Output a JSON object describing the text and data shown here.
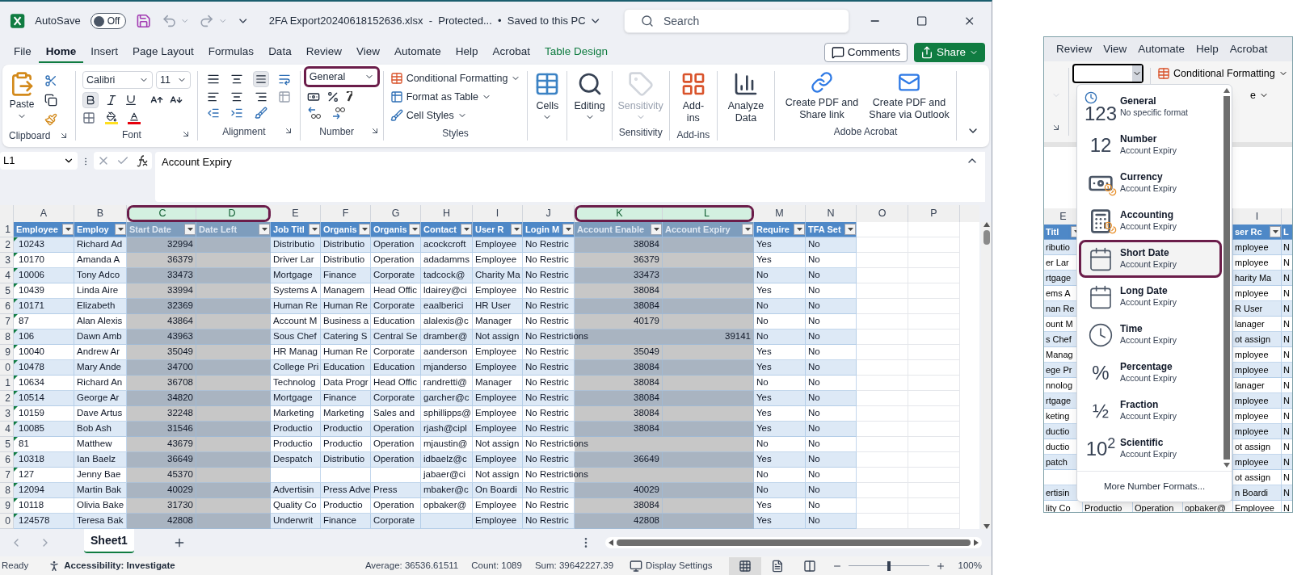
{
  "title_bar": {
    "autosave_label": "AutoSave",
    "autosave": {
      "on": false,
      "label": "Off"
    },
    "title": "2FA Export20240618152636.xlsx  -  Protected...  •  Saved to this PC",
    "search_placeholder": "Search"
  },
  "tabs": [
    {
      "label": "File",
      "selected": false,
      "kind": "normal"
    },
    {
      "label": "Home",
      "selected": true,
      "kind": "normal"
    },
    {
      "label": "Insert",
      "selected": false,
      "kind": "normal"
    },
    {
      "label": "Page Layout",
      "selected": false,
      "kind": "normal"
    },
    {
      "label": "Formulas",
      "selected": false,
      "kind": "normal"
    },
    {
      "label": "Data",
      "selected": false,
      "kind": "normal"
    },
    {
      "label": "Review",
      "selected": false,
      "kind": "normal"
    },
    {
      "label": "View",
      "selected": false,
      "kind": "normal"
    },
    {
      "label": "Automate",
      "selected": false,
      "kind": "normal"
    },
    {
      "label": "Help",
      "selected": false,
      "kind": "normal"
    },
    {
      "label": "Acrobat",
      "selected": false,
      "kind": "normal"
    },
    {
      "label": "Table Design",
      "selected": false,
      "kind": "contextual"
    }
  ],
  "comments_button": "Comments",
  "share_button": "Share",
  "ribbon": {
    "clipboard": {
      "paste": "Paste",
      "label": "Clipboard"
    },
    "font": {
      "name": "Calibri",
      "size": "11",
      "label": "Font"
    },
    "alignment": {
      "label": "Alignment"
    },
    "number": {
      "format": "General",
      "highlighted": true,
      "label": "Number"
    },
    "styles": {
      "items": [
        "Conditional Formatting",
        "Format as Table",
        "Cell Styles"
      ],
      "label": "Styles"
    },
    "tool_groups": [
      {
        "buttons": [
          {
            "kind": "cells",
            "label": "Cells",
            "dropdown": true,
            "disabled": false
          }
        ]
      },
      {
        "buttons": [
          {
            "kind": "editing",
            "label": "Editing",
            "dropdown": true,
            "disabled": false
          }
        ]
      },
      {
        "label": "Sensitivity",
        "buttons": [
          {
            "kind": "sensitivity",
            "label": "Sensitivity",
            "dropdown": true,
            "disabled": true
          }
        ]
      },
      {
        "label": "Add-ins",
        "buttons": [
          {
            "kind": "addins",
            "label": "Add-ins",
            "dropdown": false,
            "disabled": false
          }
        ]
      },
      {
        "buttons": [
          {
            "kind": "analyze",
            "label": "Analyze Data",
            "dropdown": false,
            "disabled": false
          }
        ]
      },
      {
        "label": "Adobe Acrobat",
        "buttons": [
          {
            "kind": "pdf_link",
            "label": "Create PDF and Share link",
            "dropdown": false,
            "disabled": false
          },
          {
            "kind": "pdf_mail",
            "label": "Create PDF and Share via Outlook",
            "dropdown": false,
            "disabled": false
          }
        ]
      }
    ]
  },
  "formula_bar": {
    "name_box": "L1",
    "formula": "Account Expiry"
  },
  "grid": {
    "columns": [
      {
        "letter": "A",
        "selected": false,
        "numeric": false
      },
      {
        "letter": "B",
        "selected": false,
        "numeric": false
      },
      {
        "letter": "C",
        "selected": true,
        "numeric": true
      },
      {
        "letter": "D",
        "selected": true
      },
      {
        "letter": "E",
        "selected": false,
        "numeric": false
      },
      {
        "letter": "F",
        "selected": false,
        "numeric": false
      },
      {
        "letter": "G",
        "selected": false,
        "numeric": false
      },
      {
        "letter": "H",
        "selected": false,
        "numeric": false
      },
      {
        "letter": "I",
        "selected": false,
        "numeric": false
      },
      {
        "letter": "J",
        "selected": false,
        "numeric": false
      },
      {
        "letter": "K",
        "selected": true,
        "numeric": true
      },
      {
        "letter": "L",
        "selected": true,
        "numeric": true
      },
      {
        "letter": "M",
        "selected": false,
        "numeric": false
      },
      {
        "letter": "N",
        "selected": false,
        "numeric": false
      },
      {
        "letter": "O",
        "selected": false
      },
      {
        "letter": "P",
        "selected": false
      }
    ],
    "header_row": {
      "n": "1",
      "cells": {
        "A": "Employee",
        "B": "Employ",
        "C": "Start Date",
        "D": "Date Left",
        "E": "Job Titl",
        "F": "Organis",
        "G": "Organis",
        "H": "Contact",
        "I": "User R",
        "J": "Login M",
        "K": "Account Enable",
        "L": "Account Expiry",
        "M": "Require",
        "N": "TFA Set"
      }
    },
    "rows": [
      {
        "n": "2",
        "cells": {
          "A": "10243",
          "B": "Richard Ad",
          "C": "32994",
          "E": "Distributio",
          "F": "Distributio",
          "G": "Operation",
          "H": "acockcroft",
          "I": "Employee",
          "J": "No Restric",
          "K": "38084",
          "M": "Yes",
          "N": "No"
        }
      },
      {
        "n": "3",
        "cells": {
          "A": "10170",
          "B": "Amanda A",
          "C": "36379",
          "E": "Driver Lar",
          "F": "Distributio",
          "G": "Operation",
          "H": "adadamms",
          "I": "Employee",
          "J": "No Restric",
          "K": "36379",
          "M": "Yes",
          "N": "No"
        }
      },
      {
        "n": "4",
        "cells": {
          "A": "10006",
          "B": "Tony Adco",
          "C": "33473",
          "E": "Mortgage",
          "F": "Finance",
          "G": "Corporate",
          "H": "tadcock@",
          "I": "Charity Ma",
          "J": "No Restric",
          "K": "33473",
          "M": "No",
          "N": "No"
        }
      },
      {
        "n": "5",
        "cells": {
          "A": "10439",
          "B": "Linda Aire",
          "C": "33994",
          "E": "Systems A",
          "F": "Managem",
          "G": "Head Offic",
          "H": "ldairey@ci",
          "I": "Employee",
          "J": "No Restric",
          "K": "38084",
          "M": "Yes",
          "N": "No"
        }
      },
      {
        "n": "6",
        "cells": {
          "A": "10171",
          "B": "Elizabeth",
          "C": "32369",
          "E": "Human Re",
          "F": "Human Re",
          "G": "Corporate",
          "H": "eaalberici",
          "I": "HR User",
          "J": "No Restric",
          "K": "38084",
          "M": "No",
          "N": "No"
        }
      },
      {
        "n": "7",
        "cells": {
          "A": "87",
          "B": "Alan Alexis",
          "C": "43864",
          "E": "Account M",
          "F": "Business a",
          "G": "Education",
          "H": "alalexis@c",
          "I": "Manager",
          "J": "No Restric",
          "K": "40179",
          "M": "No",
          "N": "No"
        }
      },
      {
        "n": "8",
        "cells": {
          "A": "106",
          "B": "Dawn Amb",
          "C": "43963",
          "E": "Sous Chef",
          "F": "Catering S",
          "G": "Central Se",
          "H": "dramber@",
          "I": "Not assign",
          "J": "No Restrictions",
          "L": "39141",
          "M": "No",
          "N": "No"
        }
      },
      {
        "n": "9",
        "cells": {
          "A": "10040",
          "B": "Andrew Ar",
          "C": "35049",
          "E": "HR Manag",
          "F": "Human Re",
          "G": "Corporate",
          "H": "aanderson",
          "I": "Employee",
          "J": "No Restric",
          "K": "35049",
          "M": "Yes",
          "N": "No"
        }
      },
      {
        "n": "0",
        "cells": {
          "A": "10478",
          "B": "Mary Ande",
          "C": "34700",
          "E": "College Pri",
          "F": "Education",
          "G": "Education",
          "H": "mjanderso",
          "I": "Employee",
          "J": "No Restric",
          "K": "38084",
          "M": "Yes",
          "N": "No"
        }
      },
      {
        "n": "1",
        "cells": {
          "A": "10634",
          "B": "Richard An",
          "C": "36708",
          "E": "Technolog",
          "F": "Data Progr",
          "G": "Head Offic",
          "H": "randretti@",
          "I": "Manager",
          "J": "No Restric",
          "K": "38084",
          "M": "No",
          "N": "No"
        }
      },
      {
        "n": "2",
        "cells": {
          "A": "10514",
          "B": "George Ar",
          "C": "34820",
          "E": "Mortgage",
          "F": "Finance",
          "G": "Corporate",
          "H": "garcher@c",
          "I": "Employee",
          "J": "No Restric",
          "K": "38084",
          "M": "Yes",
          "N": "No"
        }
      },
      {
        "n": "3",
        "cells": {
          "A": "10159",
          "B": "Dave Artus",
          "C": "32248",
          "E": "Marketing",
          "F": "Marketing",
          "G": "Sales and",
          "H": "sphillipps@",
          "I": "Employee",
          "J": "No Restric",
          "K": "38084",
          "M": "Yes",
          "N": "No"
        }
      },
      {
        "n": "4",
        "cells": {
          "A": "10085",
          "B": "Bob Ash",
          "C": "31546",
          "E": "Productio",
          "F": "Productio",
          "G": "Operation",
          "H": "rjash@cipl",
          "I": "Employee",
          "J": "No Restric",
          "K": "38084",
          "M": "Yes",
          "N": "No"
        }
      },
      {
        "n": "5",
        "cells": {
          "A": "81",
          "B": "Matthew",
          "C": "43679",
          "E": "Productio",
          "F": "Productio",
          "G": "Operation",
          "H": "mjaustin@",
          "I": "Not assign",
          "J": "No Restrictions",
          "M": "No",
          "N": "No"
        }
      },
      {
        "n": "6",
        "cells": {
          "A": "10318",
          "B": "Ian Baelz",
          "C": "36649",
          "E": "Despatch",
          "F": "Distributio",
          "G": "Operation",
          "H": "idbaelz@c",
          "I": "Employee",
          "J": "No Restric",
          "K": "36649",
          "M": "Yes",
          "N": "No"
        }
      },
      {
        "n": "7",
        "cells": {
          "A": "127",
          "B": "Jenny Bae",
          "C": "45370",
          "H": "jabaer@ci",
          "I": "Not assign",
          "J": "No Restrictions",
          "M": "No",
          "N": "No"
        }
      },
      {
        "n": "8",
        "cells": {
          "A": "12094",
          "B": "Martin Bak",
          "C": "40029",
          "E": "Advertisin",
          "F": "Press Adve",
          "G": "Press",
          "H": "mbaker@c",
          "I": "On Boardi",
          "J": "No Restric",
          "K": "40029",
          "M": "No",
          "N": "No"
        }
      },
      {
        "n": "9",
        "cells": {
          "A": "10118",
          "B": "Olivia Bake",
          "C": "31730",
          "E": "Quality Co",
          "F": "Productio",
          "G": "Operation",
          "H": "opbaker@",
          "I": "Employee",
          "J": "No Restric",
          "K": "38084",
          "M": "Yes",
          "N": "No"
        }
      },
      {
        "n": "0",
        "cells": {
          "A": "124578",
          "B": "Teresa Bak",
          "C": "42808",
          "E": "Underwrit",
          "F": "Finance",
          "G": "Corporate",
          "I": "Employee",
          "J": "No Restric",
          "K": "42808",
          "M": "Yes",
          "N": "No"
        }
      }
    ]
  },
  "sheet_tabs": [
    {
      "label": "Sheet1",
      "selected": true
    }
  ],
  "status_bar": {
    "ready": "Ready",
    "accessibility": "Accessibility: Investigate",
    "average": "Average: 36536.61511",
    "count": "Count: 1089",
    "sum": "Sum: 39642227.39",
    "display_settings": "Display Settings",
    "views": [
      {
        "kind": "normal",
        "selected": true
      },
      {
        "kind": "page_layout",
        "selected": false
      },
      {
        "kind": "page_break",
        "selected": false
      }
    ],
    "zoom": {
      "level": 0.5,
      "label": "100%"
    }
  },
  "inset": {
    "tabs": [
      "Review",
      "View",
      "Automate",
      "Help",
      "Acrobat"
    ],
    "conditional_formatting": "Conditional Formatting",
    "format_table_tail": "e",
    "column_headers": {
      "E": "E",
      "I": "I"
    },
    "header_row": {
      "E": "Titl",
      "I": "ser Rc",
      "J": "L"
    },
    "rows": [
      {
        "E": "ributio",
        "I": "mployee",
        "J": "N"
      },
      {
        "E": "er Lar",
        "I": "mployee",
        "J": "N"
      },
      {
        "E": "rtgage",
        "I": "harity Ma",
        "J": "N"
      },
      {
        "E": "ems A",
        "I": "mployee",
        "J": "N"
      },
      {
        "E": "nan Re",
        "I": "R User",
        "J": "N"
      },
      {
        "E": "ount M",
        "I": "lanager",
        "J": "N"
      },
      {
        "E": "s Chef",
        "I": "ot assign",
        "J": "N"
      },
      {
        "E": "Manag",
        "I": "mployee",
        "J": "N"
      },
      {
        "E": "ege Pr",
        "I": "mployee",
        "J": "N"
      },
      {
        "E": "nnolog",
        "I": "lanager",
        "J": "N"
      },
      {
        "E": "rtgage",
        "I": "mployee",
        "J": "N"
      },
      {
        "E": "keting",
        "I": "mployee",
        "J": "N"
      },
      {
        "E": "ductio",
        "I": "mployee",
        "J": "N"
      },
      {
        "E": "ductio",
        "I": "ot assign",
        "J": "N"
      },
      {
        "E": "patch",
        "I": "mployee",
        "J": "N"
      },
      {
        "I": "ot assign",
        "J": "N"
      },
      {
        "E": "ertisin",
        "I": "n Boardi",
        "J": "N"
      },
      {
        "E": "lity Co",
        "F": "Productio",
        "G": "Operation",
        "H": "opbaker@",
        "I": "Employee",
        "J": "N"
      }
    ],
    "number_menu": {
      "items": [
        {
          "kind": "general",
          "glyph": "123",
          "title": "General",
          "subtitle": "No specific format",
          "highlighted": false
        },
        {
          "kind": "number",
          "glyph": "12",
          "title": "Number",
          "subtitle": "Account Expiry",
          "highlighted": false
        },
        {
          "kind": "currency",
          "title": "Currency",
          "subtitle": "Account Expiry",
          "highlighted": false
        },
        {
          "kind": "accounting",
          "title": "Accounting",
          "subtitle": "Account Expiry",
          "highlighted": false
        },
        {
          "kind": "short_date",
          "title": "Short Date",
          "subtitle": "Account Expiry",
          "highlighted": true
        },
        {
          "kind": "long_date",
          "title": "Long Date",
          "subtitle": "Account Expiry",
          "highlighted": false
        },
        {
          "kind": "time",
          "title": "Time",
          "subtitle": "Account Expiry",
          "highlighted": false
        },
        {
          "kind": "percentage",
          "glyph": "%",
          "title": "Percentage",
          "subtitle": "Account Expiry",
          "highlighted": false
        },
        {
          "kind": "fraction",
          "glyph": "½",
          "title": "Fraction",
          "subtitle": "Account Expiry",
          "highlighted": false
        },
        {
          "kind": "scientific",
          "glyph": "10$^{2}$",
          "title": "Scientific",
          "subtitle": "Account Expiry",
          "highlighted": false
        }
      ],
      "more": "More Number Formats..."
    }
  }
}
